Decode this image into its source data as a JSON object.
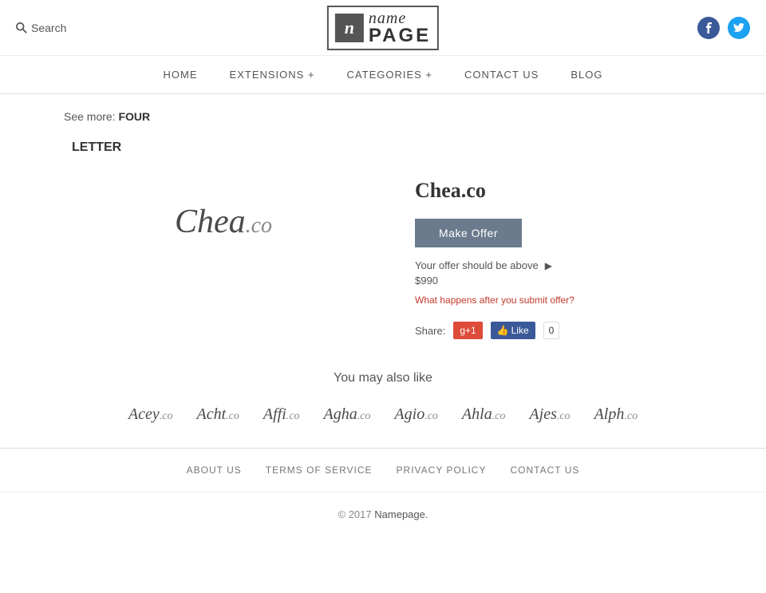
{
  "header": {
    "search_label": "Search",
    "logo_icon": "n",
    "logo_name": "name",
    "logo_page": "PAGE",
    "social": [
      {
        "name": "facebook",
        "symbol": "f"
      },
      {
        "name": "twitter",
        "symbol": "t"
      }
    ]
  },
  "nav": {
    "items": [
      {
        "label": "HOME",
        "id": "home"
      },
      {
        "label": "EXTENSIONS +",
        "id": "extensions"
      },
      {
        "label": "CATEGORIES +",
        "id": "categories"
      },
      {
        "label": "CONTACT US",
        "id": "contact"
      },
      {
        "label": "BLOG",
        "id": "blog"
      }
    ]
  },
  "breadcrumb": {
    "see_more": "See more:",
    "link": "FOUR",
    "continuation": "LETTER"
  },
  "domain": {
    "display_name": "Chea",
    "extension": ".co",
    "full_name": "Chea.co",
    "make_offer_label": "Make Offer",
    "offer_hint": "Your offer should be above",
    "offer_amount": "$990",
    "what_happens": "What happens after you submit offer?",
    "share_label": "Share:",
    "gplus_label": "g+1",
    "fb_like_label": "Like",
    "fb_count": "0"
  },
  "also_like": {
    "title": "You may also like",
    "items": [
      {
        "name": "Acey",
        "ext": ".co"
      },
      {
        "name": "Acht",
        "ext": ".co"
      },
      {
        "name": "Affi",
        "ext": ".co"
      },
      {
        "name": "Agha",
        "ext": ".co"
      },
      {
        "name": "Agio",
        "ext": ".co"
      },
      {
        "name": "Ahla",
        "ext": ".co"
      },
      {
        "name": "Ajes",
        "ext": ".co"
      },
      {
        "name": "Alph",
        "ext": ".co"
      }
    ]
  },
  "footer": {
    "nav_items": [
      {
        "label": "ABOUT US",
        "id": "about"
      },
      {
        "label": "TERMS OF SERVICE",
        "id": "terms"
      },
      {
        "label": "PRIVACY POLICY",
        "id": "privacy"
      },
      {
        "label": "CONTACT US",
        "id": "contact"
      }
    ],
    "copyright": "© 2017",
    "brand": "Namepage."
  }
}
